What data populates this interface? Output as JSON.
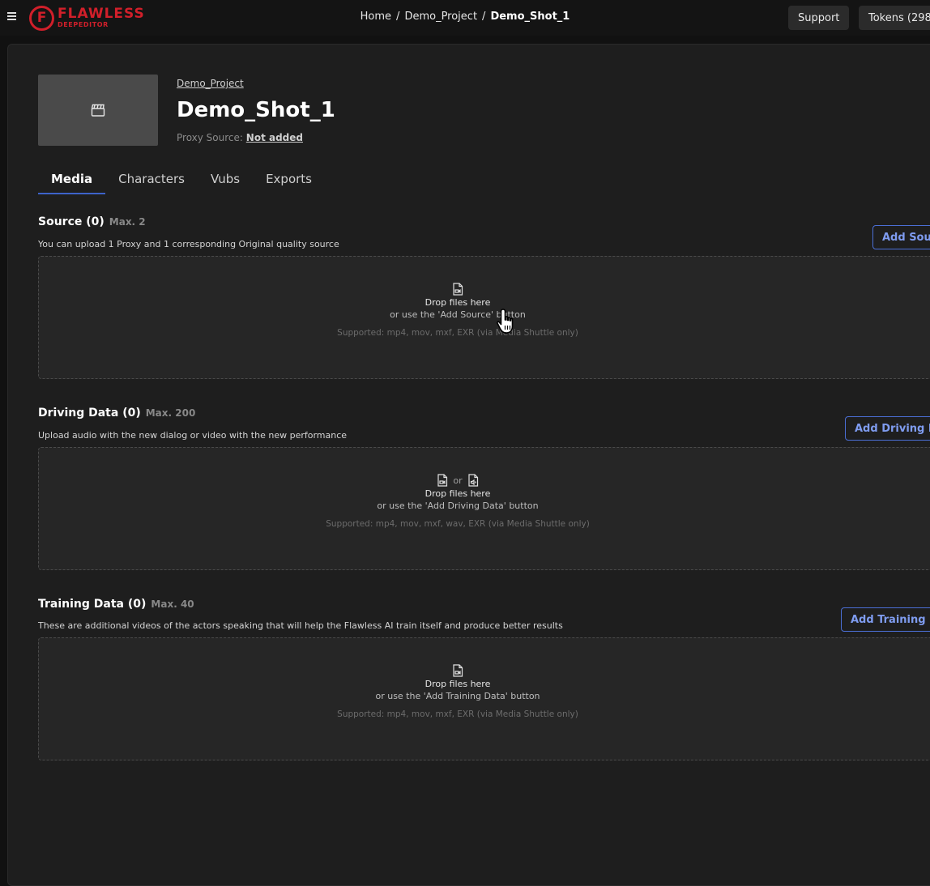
{
  "header": {
    "logo_word": "FLAWLESS",
    "logo_sub": "DEEPEDITOR",
    "breadcrumb": [
      "Home",
      "Demo_Project",
      "Demo_Shot_1"
    ],
    "support_label": "Support",
    "tokens_label": "Tokens (298"
  },
  "shot": {
    "project_link": "Demo_Project",
    "title": "Demo_Shot_1",
    "proxy_label": "Proxy Source:",
    "proxy_value": "Not added"
  },
  "tabs": [
    {
      "label": "Media",
      "active": true
    },
    {
      "label": "Characters",
      "active": false
    },
    {
      "label": "Vubs",
      "active": false
    },
    {
      "label": "Exports",
      "active": false
    }
  ],
  "sections": {
    "source": {
      "title": "Source (0)",
      "max": "Max. 2",
      "desc": "You can upload 1 Proxy and 1 corresponding Original quality source",
      "button": "Add Source",
      "drop": "Drop files here",
      "hint": "or use the 'Add Source' button",
      "supported": "Supported: mp4, mov, mxf, EXR (via Media Shuttle only)"
    },
    "driving": {
      "title": "Driving Data (0)",
      "max": "Max. 200",
      "desc": "Upload audio with the new dialog or video with the new performance",
      "button": "Add Driving Data",
      "or": "or",
      "drop": "Drop files here",
      "hint": "or use the 'Add Driving Data' button",
      "supported": "Supported: mp4, mov, mxf, wav, EXR (via Media Shuttle only)"
    },
    "training": {
      "title": "Training Data (0)",
      "max": "Max. 40",
      "desc": "These are additional videos of the actors speaking that will help the Flawless AI train itself and produce better results",
      "button": "Add Training Data",
      "drop": "Drop files here",
      "hint": "or use the 'Add Training Data' button",
      "supported": "Supported: mp4, mov, mxf, EXR (via Media Shuttle only)"
    }
  },
  "icons": {
    "menu": "hamburger-menu-icon",
    "clapper": "clapperboard-icon",
    "video_file": "video-file-icon",
    "audio_file": "audio-file-icon",
    "cursor": "hand-pointer-cursor-icon"
  },
  "colors": {
    "brand": "#d11f2a",
    "accent": "#4b6fd6",
    "tab_indicator": "#3d63c9"
  }
}
